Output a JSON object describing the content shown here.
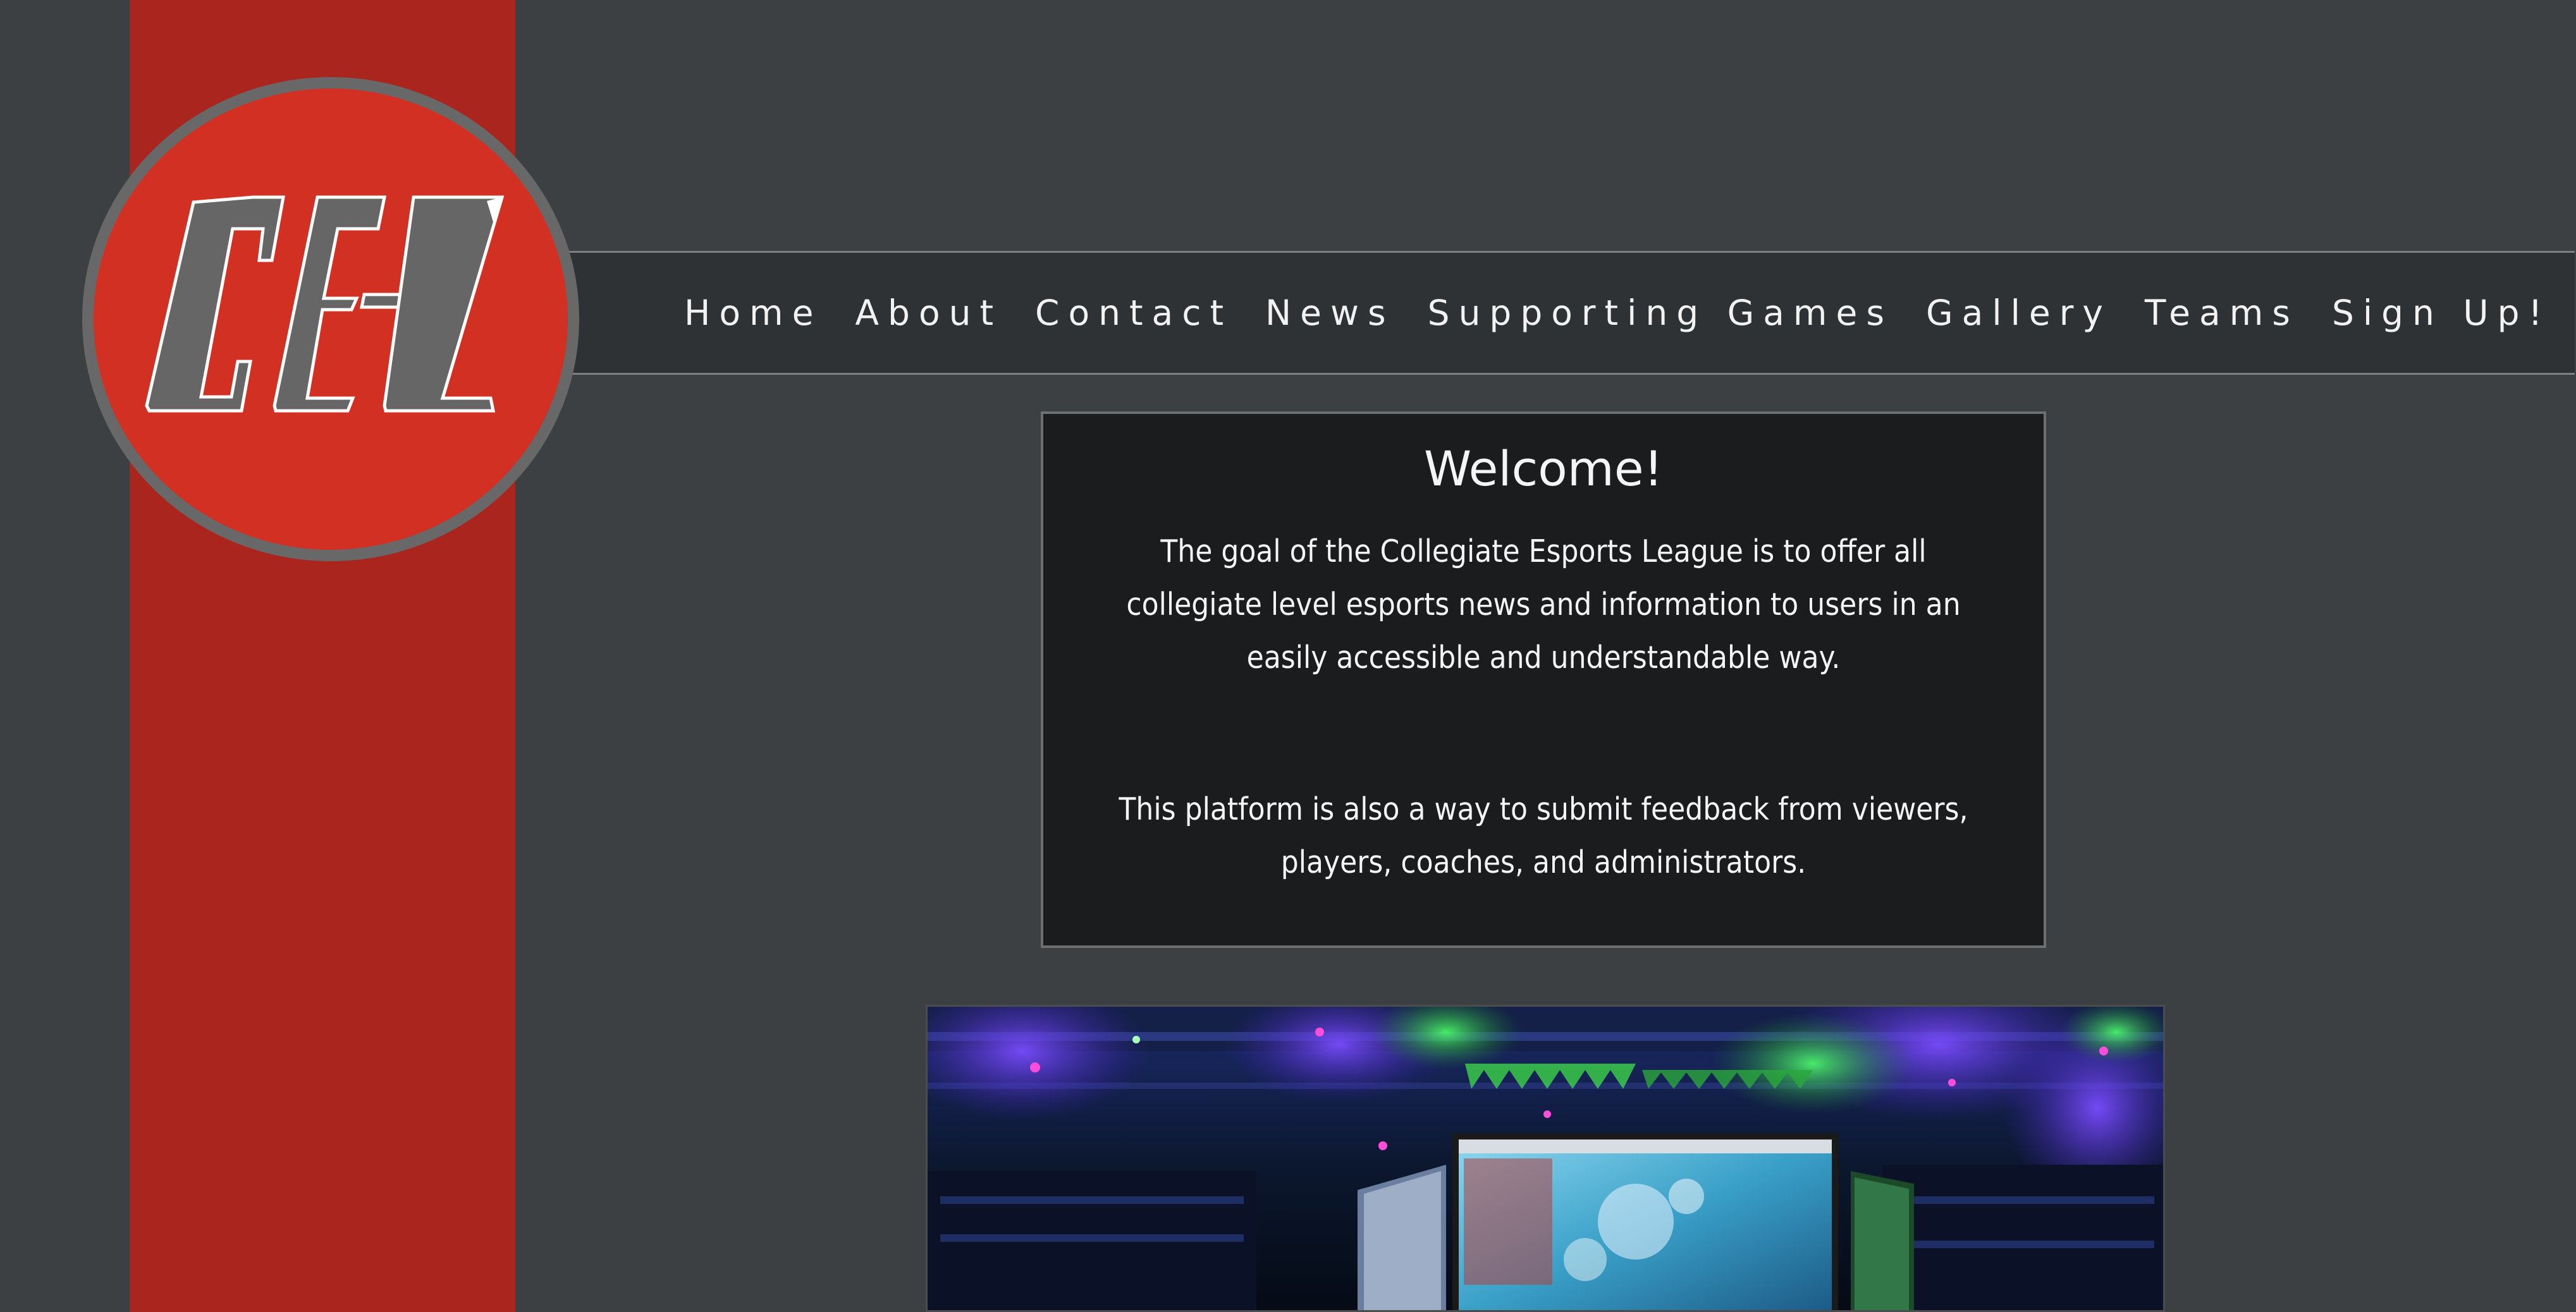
{
  "logo": {
    "text": "CEL",
    "colors": {
      "circle": "#d13023",
      "ring": "#686868",
      "letters": "#666666",
      "outline": "#ffffff"
    }
  },
  "nav": {
    "items": [
      {
        "label": "Home",
        "icon": null
      },
      {
        "label": "About",
        "icon": null
      },
      {
        "label": "Contact",
        "icon": null
      },
      {
        "label": "News",
        "icon": null
      },
      {
        "label": "Supporting Games",
        "icon": null
      },
      {
        "label": "Gallery",
        "icon": null
      },
      {
        "label": "Teams",
        "icon": null
      },
      {
        "label": "Sign Up!",
        "icon": null
      }
    ]
  },
  "welcome": {
    "title": "Welcome!",
    "paragraph1": "The goal of the Collegiate Esports League is to offer all collegiate level esports news and information to users in an easily accessible and understandable way.",
    "paragraph2": "This platform is also a way to submit feedback from viewers, players, coaches, and administrators."
  },
  "photo": {
    "description_icon": "esports-arena-photo"
  },
  "colors": {
    "page_background": "#3d4043",
    "sidebar_red": "#aa251e",
    "navbar_background": "#2f3234",
    "panel_background": "#1b1c1e",
    "text": "#f2f2f2"
  }
}
